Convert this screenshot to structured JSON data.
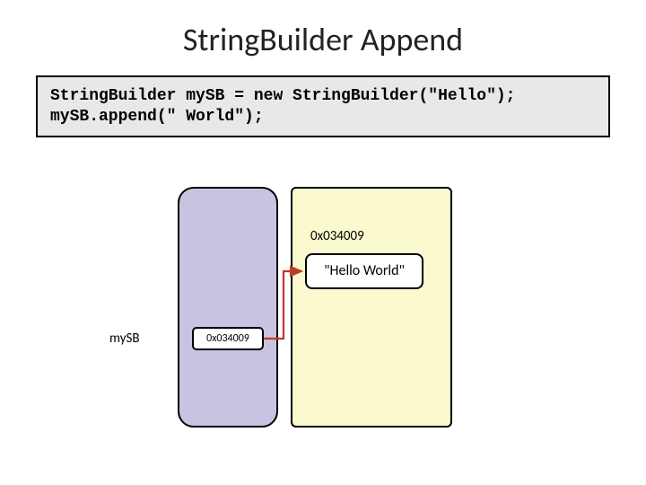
{
  "title": "StringBuilder Append",
  "code": "StringBuilder mySB = new StringBuilder(\"Hello\");\nmySB.append(\" World\");",
  "diagram": {
    "varLabel": "mySB",
    "stackCell": "0x034009",
    "addrLabel": "0x034009",
    "heapCell": "\"Hello World\""
  },
  "colors": {
    "arrow": "#c0392b"
  }
}
